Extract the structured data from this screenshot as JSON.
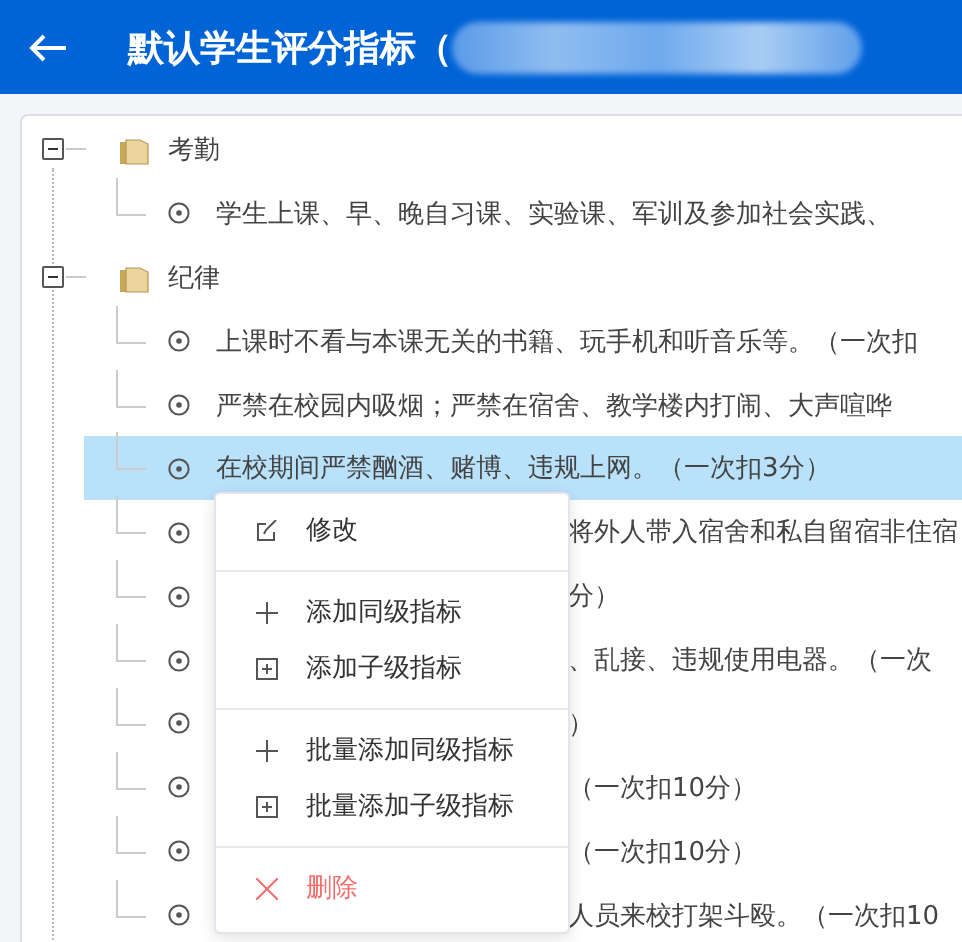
{
  "header": {
    "title": "默认学生评分指标（"
  },
  "tree": [
    {
      "label": "考勤",
      "expanded": true,
      "children": [
        {
          "text": "学生上课、早、晚自习课、实验课、军训及参加社会实践、",
          "selected": false,
          "covered": false
        }
      ]
    },
    {
      "label": "纪律",
      "expanded": true,
      "children": [
        {
          "text": "上课时不看与本课无关的书籍、玩手机和听音乐等。（一次扣",
          "selected": false,
          "covered": false
        },
        {
          "text": "严禁在校园内吸烟；严禁在宿舍、教学楼内打闹、大声喧哗",
          "selected": false,
          "covered": false
        },
        {
          "text": "在校期间严禁酗酒、赌博、违规上网。（一次扣3分）",
          "selected": true,
          "covered": false
        },
        {
          "text": "将外人带入宿舍和私自留宿非住宿",
          "selected": false,
          "covered": true
        },
        {
          "text": "分）",
          "selected": false,
          "covered": true
        },
        {
          "text": "、乱接、违规使用电器。（一次",
          "selected": false,
          "covered": true
        },
        {
          "text": "）",
          "selected": false,
          "covered": true
        },
        {
          "text": "（一次扣10分）",
          "selected": false,
          "covered": true
        },
        {
          "text": "（一次扣10分）",
          "selected": false,
          "covered": true
        },
        {
          "text": "人员来校打架斗殴。（一次扣10",
          "selected": false,
          "covered": true
        }
      ]
    }
  ],
  "context_menu": [
    {
      "kind": "edit",
      "label": "修改"
    },
    {
      "kind": "divider"
    },
    {
      "kind": "plus",
      "label": "添加同级指标"
    },
    {
      "kind": "boxplus",
      "label": "添加子级指标"
    },
    {
      "kind": "divider"
    },
    {
      "kind": "plus",
      "label": "批量添加同级指标"
    },
    {
      "kind": "boxplus",
      "label": "批量添加子级指标"
    },
    {
      "kind": "divider"
    },
    {
      "kind": "delete",
      "label": "删除"
    }
  ]
}
